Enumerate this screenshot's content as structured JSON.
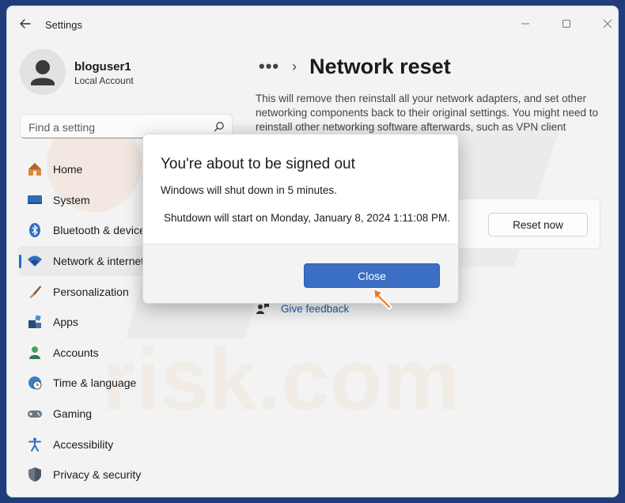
{
  "window": {
    "title": "Settings"
  },
  "account": {
    "name": "bloguser1",
    "type": "Local Account"
  },
  "search": {
    "placeholder": "Find a setting"
  },
  "sidebar": {
    "items": [
      {
        "label": "Home",
        "icon": "home-icon"
      },
      {
        "label": "System",
        "icon": "system-icon"
      },
      {
        "label": "Bluetooth & devices",
        "icon": "bluetooth-icon"
      },
      {
        "label": "Network & internet",
        "icon": "wifi-icon",
        "active": true
      },
      {
        "label": "Personalization",
        "icon": "brush-icon"
      },
      {
        "label": "Apps",
        "icon": "apps-icon"
      },
      {
        "label": "Accounts",
        "icon": "accounts-icon"
      },
      {
        "label": "Time & language",
        "icon": "globe-clock-icon"
      },
      {
        "label": "Gaming",
        "icon": "gamepad-icon"
      },
      {
        "label": "Accessibility",
        "icon": "accessibility-icon"
      },
      {
        "label": "Privacy & security",
        "icon": "shield-icon"
      }
    ]
  },
  "main": {
    "breadcrumb_more": "•••",
    "title": "Network reset",
    "description": "This will remove then reinstall all your network adapters, and set other networking components back to their original settings. You might need to reinstall other networking software afterwards, such as VPN client",
    "reset_button": "Reset now",
    "feedback_label": "Give feedback"
  },
  "dialog": {
    "title": "You're about to be signed out",
    "message": "Windows will shut down in 5 minutes.",
    "shutdown_info": "Shutdown will start on Monday, January 8, 2024 1:11:08 PM.",
    "close_button": "Close"
  },
  "colors": {
    "accent": "#3a6fc4",
    "link": "#1f5fb0",
    "cursor": "#f07b23",
    "background": "#1f3d7a"
  }
}
